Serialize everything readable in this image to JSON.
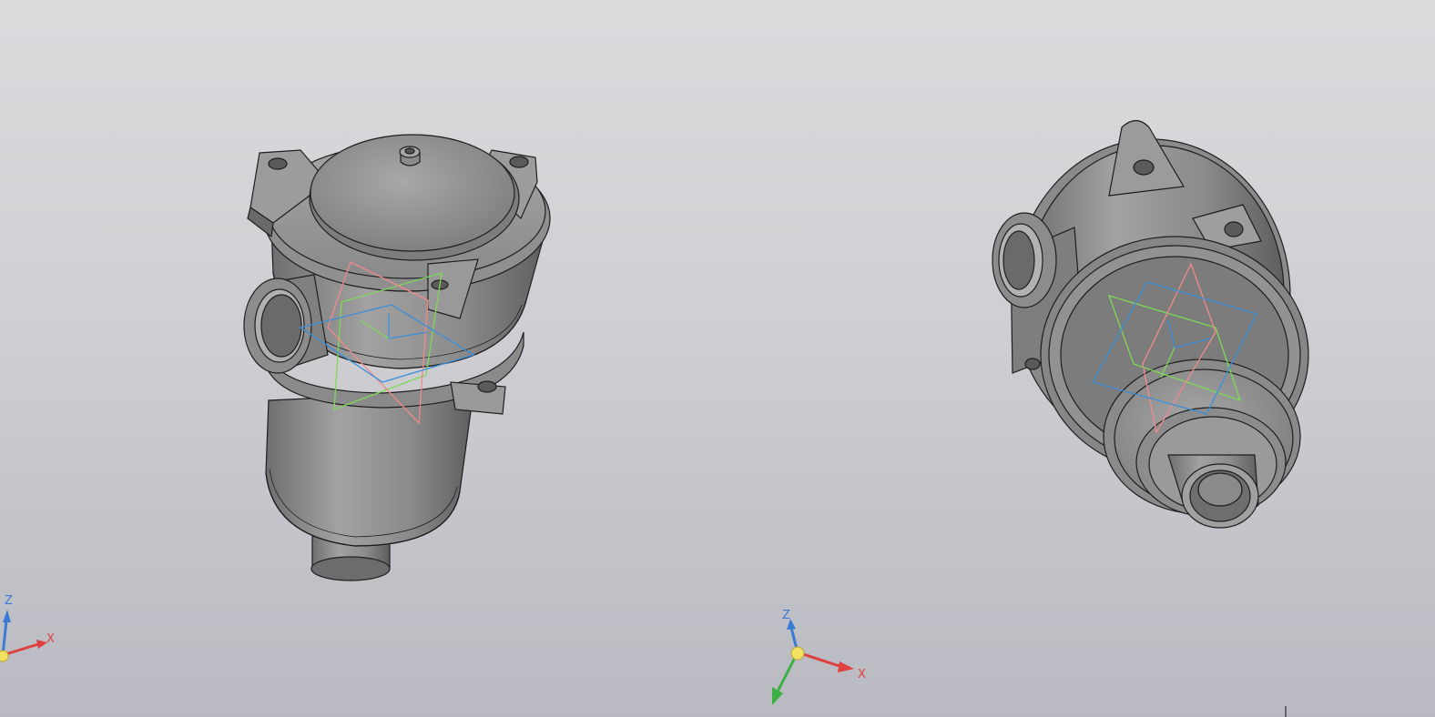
{
  "viewport": {
    "background_top": "#dcdcdf",
    "background_bottom": "#b9b9c1"
  },
  "colors": {
    "model_fill": "#8e8e8e",
    "model_dark": "#6a6a6a",
    "model_light": "#a9a9a9",
    "edge": "#1e1e1e",
    "plane_xy": "#3a8fd8",
    "plane_xz": "#7ed957",
    "plane_yz": "#ef8a8a",
    "axis_x": "#e04040",
    "axis_y": "#3cb043",
    "axis_z": "#3a7bd5",
    "origin": "#f2e060"
  },
  "triads": {
    "left": {
      "x_label": "X",
      "z_label": "Z"
    },
    "center": {
      "x_label": "X",
      "z_label": "Z"
    }
  }
}
